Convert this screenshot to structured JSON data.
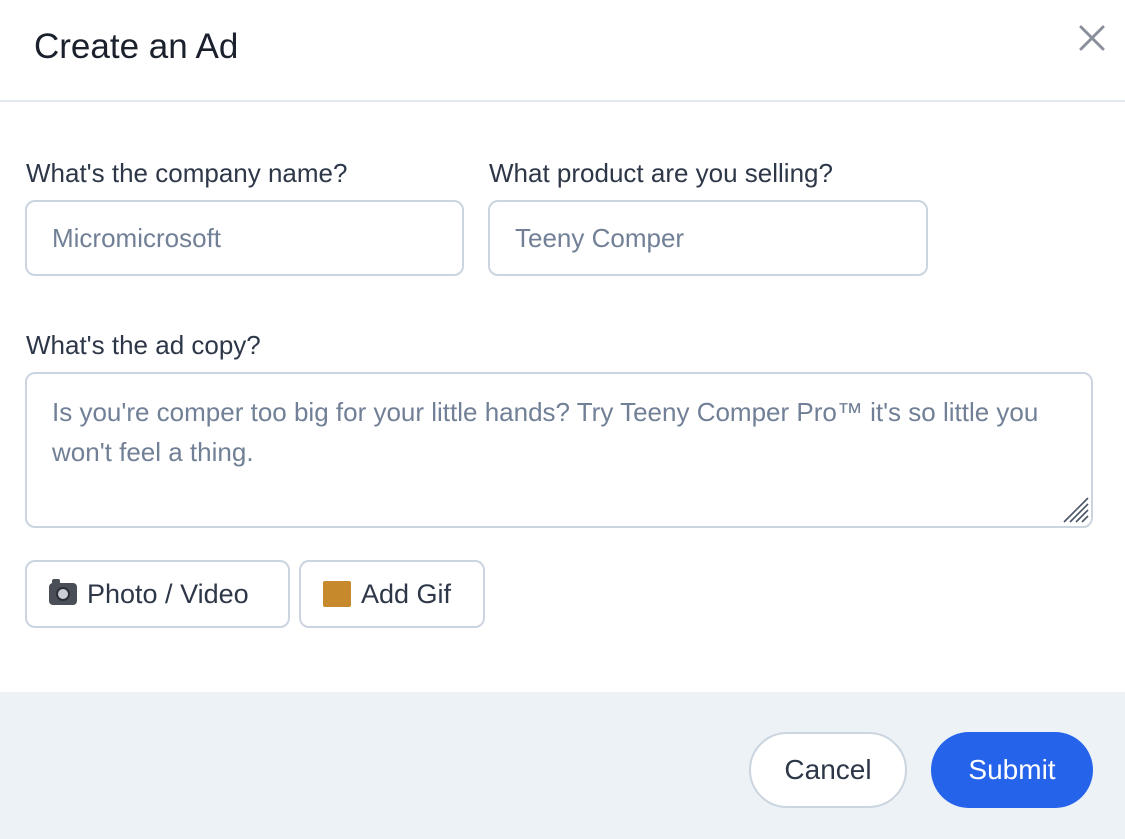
{
  "modal": {
    "title": "Create an Ad"
  },
  "form": {
    "company": {
      "label": "What's the company name?",
      "placeholder": "Micromicrosoft",
      "value": ""
    },
    "product": {
      "label": "What product are you selling?",
      "placeholder": "Teeny Comper",
      "value": ""
    },
    "ad_copy": {
      "label": "What's the ad copy?",
      "placeholder": "Is you're comper too big for your little hands? Try Teeny Comper Pro™ it's so little you won't feel a thing.",
      "value": ""
    },
    "media_buttons": {
      "photo_video": {
        "icon": "camera-icon",
        "label": "Photo / Video"
      },
      "add_gif": {
        "icon": "framed-picture-icon",
        "label": "Add Gif"
      }
    }
  },
  "footer": {
    "cancel_label": "Cancel",
    "submit_label": "Submit"
  },
  "colors": {
    "primary": "#2563eb",
    "footer_bg": "#edf2f7",
    "border": "#cbd5e0"
  }
}
